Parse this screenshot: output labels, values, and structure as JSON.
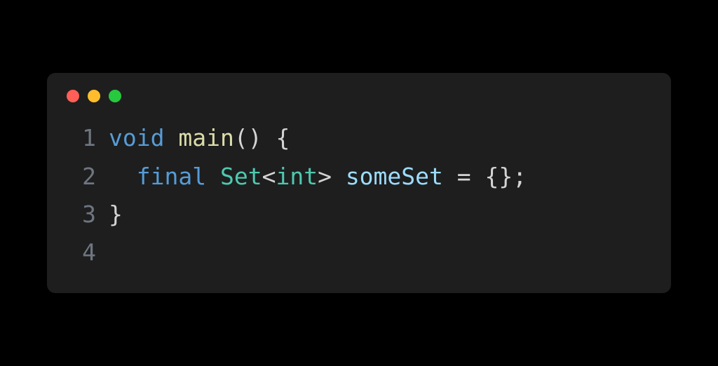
{
  "lines": [
    {
      "number": "1"
    },
    {
      "number": "2"
    },
    {
      "number": "3"
    },
    {
      "number": "4"
    }
  ],
  "code": {
    "line1": {
      "t1": "void",
      "t2": " ",
      "t3": "main",
      "t4": "()",
      "t5": " ",
      "t6": "{"
    },
    "line2": {
      "t1": "  ",
      "t2": "final",
      "t3": " ",
      "t4": "Set",
      "t5": "<",
      "t6": "int",
      "t7": ">",
      "t8": " ",
      "t9": "someSet",
      "t10": " ",
      "t11": "=",
      "t12": " ",
      "t13": "{}",
      "t14": ";"
    },
    "line3": {
      "t1": "}"
    }
  }
}
